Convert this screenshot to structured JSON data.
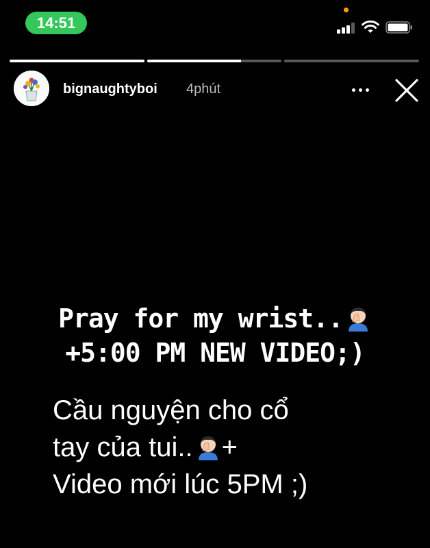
{
  "status_bar": {
    "time": "14:51"
  },
  "story": {
    "segments": [
      {
        "progress": 1.0
      },
      {
        "progress": 0.7
      },
      {
        "progress": 0.0
      }
    ],
    "username": "bignaughtyboi",
    "time_ago": "4phút",
    "english_lines": [
      "Pray for my wrist..",
      "+5:00 PM NEW VIDEO;)"
    ],
    "vietnamese_lines": [
      "Cầu nguyện cho cổ",
      "tay của tui..",
      "Video mới lúc 5PM ;)"
    ],
    "vietnamese_suffix": "+",
    "emoji": "man-facepalming-icon"
  }
}
